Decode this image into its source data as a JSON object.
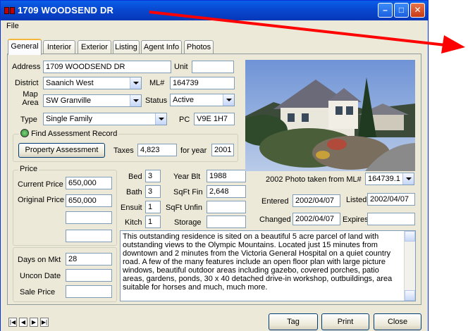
{
  "window": {
    "title": "1709 WOODSEND DR"
  },
  "menu": {
    "file": "File"
  },
  "tabs": [
    "General",
    "Interior",
    "Exterior",
    "Listing",
    "Agent Info",
    "Photos"
  ],
  "general": {
    "address_label": "Address",
    "address": "1709 WOODSEND DR",
    "unit_label": "Unit",
    "unit": "",
    "district_label": "District",
    "district": "Saanich West",
    "ml_label": "ML#",
    "ml": "164739",
    "map_area_label": "Map Area",
    "map_area": "SW Granville",
    "status_label": "Status",
    "status": "Active",
    "type_label": "Type",
    "type": "Single Family",
    "pc_label": "PC",
    "pc": "V9E 1H7",
    "assessment_group": "Find Assessment Record",
    "property_assessment": "Property Assessment",
    "taxes_label": "Taxes",
    "taxes": "4,823",
    "for_year_label": "for year",
    "for_year": "2001"
  },
  "price": {
    "group": "Price",
    "current_label": "Current Price",
    "current": "650,000",
    "original_label": "Original Price",
    "original": "650,000",
    "extra1": "",
    "extra2": "",
    "days_label": "Days on Mkt",
    "days": "28",
    "uncon_label": "Uncon Date",
    "uncon": "",
    "sale_label": "Sale Price",
    "sale": ""
  },
  "rooms": {
    "bed_label": "Bed",
    "bed": "3",
    "bath_label": "Bath",
    "bath": "3",
    "ensuit_label": "Ensuit",
    "ensuit": "1",
    "kitch_label": "Kitch",
    "kitch": "1",
    "yearblt_label": "Year Blt",
    "yearblt": "1988",
    "sqftfin_label": "SqFt Fin",
    "sqftfin": "2,648",
    "sqftunfin_label": "SqFt Unfin",
    "sqftunfin": "",
    "storage_label": "Storage",
    "storage": ""
  },
  "photo": {
    "caption_label": "2002 Photo taken from ML#",
    "caption_ml": "164739.1"
  },
  "dates": {
    "entered_label": "Entered",
    "entered": "2002/04/07",
    "listed_label": "Listed",
    "listed": "2002/04/07",
    "changed_label": "Changed",
    "changed": "2002/04/07",
    "expires_label": "Expires",
    "expires": ""
  },
  "remarks": "This outstanding residence is sited on a beautiful 5 acre parcel of land with outstanding views to the Olympic Mountains. Located just 15 minutes from downtown and 2 minutes from the Victoria General Hospital on a quiet country road. A few of the many features include an open floor plan with large picture windows, beautiful outdoor areas including gazebo, covered porches, patio areas, gardens, ponds,  30 x 40 detached drive-in workshop, outbuildings, area suitable for horses and much, much more.",
  "buttons": {
    "tag": "Tag",
    "print": "Print",
    "close": "Close"
  },
  "nav": {
    "first": "|◀",
    "prev": "◀",
    "next": "▶",
    "last": "▶|"
  },
  "colors": {
    "titlebar": "#0848d0",
    "annotation_arrow": "#ff0000"
  }
}
